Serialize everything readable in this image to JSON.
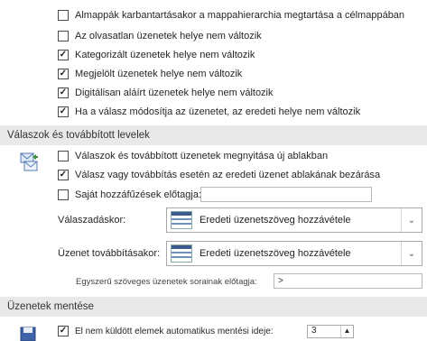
{
  "top_options": [
    {
      "label": "Almappák karbantartásakor a mappahierarchia megtartása a célmappában",
      "checked": false
    },
    {
      "label": "Az olvasatlan üzenetek helye nem változik",
      "checked": false
    },
    {
      "label": "Kategorizált üzenetek helye nem változik",
      "checked": true
    },
    {
      "label": "Megjelölt üzenetek helye nem változik",
      "checked": true
    },
    {
      "label": "Digitálisan aláírt üzenetek helye nem változik",
      "checked": true
    },
    {
      "label": "Ha a válasz módosítja az üzenetet, az eredeti helye nem változik",
      "checked": true
    }
  ],
  "replies_section": {
    "title": "Válaszok és továbbított levelek",
    "options": [
      {
        "label": "Válaszok és továbbított üzenetek megnyitása új ablakban",
        "checked": false
      },
      {
        "label": "Válasz vagy továbbítás esetén az eredeti üzenet ablakának bezárása",
        "checked": true
      },
      {
        "label": "Saját hozzáfűzések előtagja:",
        "checked": false
      }
    ],
    "reply_label": "Válaszadáskor:",
    "reply_value": "Eredeti üzenetszöveg hozzávétele",
    "forward_label": "Üzenet továbbításakor:",
    "forward_value": "Eredeti üzenetszöveg hozzávétele",
    "prefix_label": "Egyszerű szöveges üzenetek sorainak előtagja:",
    "prefix_value": ">"
  },
  "save_section": {
    "title": "Üzenetek mentése",
    "option_label": "El nem küldött elemek automatikus mentési ideje:",
    "option_checked": true,
    "minutes_value": "3",
    "stepper_glyph": "▲"
  },
  "icons": {
    "check": "✓",
    "dropdown": "⌄",
    "mail_icon": "reply-forward-icon",
    "save_icon": "floppy-disk-icon"
  }
}
